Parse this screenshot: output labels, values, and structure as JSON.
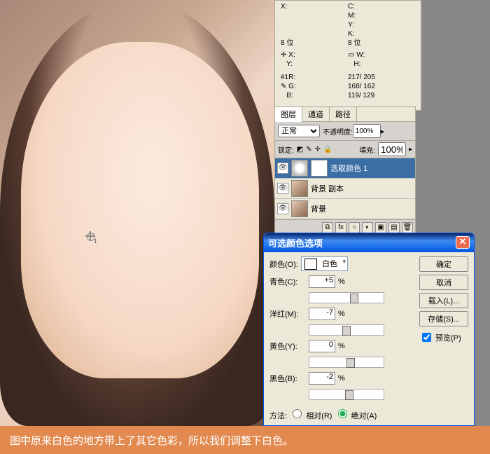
{
  "canvas": {
    "marker_index": "1"
  },
  "info": {
    "xlabel": "X:",
    "ylabel": "Y:",
    "clabel": "C:",
    "mlabel": "M:",
    "ylabel2": "Y:",
    "klabel": "K:",
    "bits": "8 位",
    "wlabel": "W:",
    "hlabel": "H:",
    "sample": "#1",
    "r_label": "R:",
    "g_label": "G:",
    "b_label": "B:",
    "r": "217/ 205",
    "g": "168/ 162",
    "b": "119/ 129"
  },
  "tabs": {
    "layers": "图层",
    "channels": "通道",
    "paths": "路径"
  },
  "blend": {
    "mode": "正常",
    "opacity_label": "不透明度:",
    "opacity": "100%",
    "fill_label": "填充:",
    "fill": "100%",
    "lock": "锁定:"
  },
  "layers": [
    {
      "name": "选取颜色 1",
      "type": "adj",
      "active": true
    },
    {
      "name": "背景 副本",
      "type": "photo",
      "active": false
    },
    {
      "name": "背景",
      "type": "photo",
      "active": false
    }
  ],
  "dialog": {
    "title": "可选颜色选项",
    "color_label": "颜色(O):",
    "color_value": "白色",
    "rows": [
      {
        "label": "青色(C):",
        "value": "+5",
        "handle": "55%"
      },
      {
        "label": "洋红(M):",
        "value": "-7",
        "handle": "44%"
      },
      {
        "label": "黄色(Y):",
        "value": "0",
        "handle": "50%"
      },
      {
        "label": "黑色(B):",
        "value": "-2",
        "handle": "48%"
      }
    ],
    "pct": "%",
    "method": "方法:",
    "rel": "相对(R)",
    "abs": "绝对(A)",
    "ok": "确定",
    "cancel": "取消",
    "load": "载入(L)...",
    "save": "存储(S)...",
    "preview": "预览(P)"
  },
  "caption": "图中原来白色的地方带上了其它色彩，所以我们调整下白色。"
}
